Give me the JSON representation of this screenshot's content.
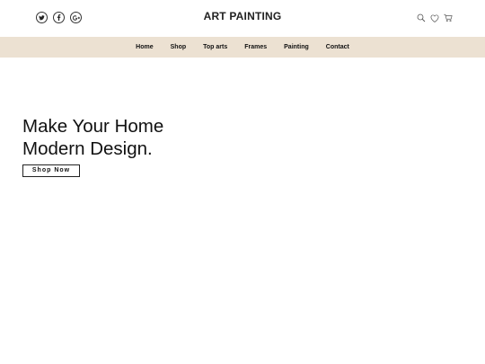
{
  "header": {
    "brand": "ART PAINTING",
    "social": [
      {
        "icon": "twitter-icon"
      },
      {
        "icon": "facebook-icon"
      },
      {
        "icon": "google-plus-icon"
      }
    ],
    "utilities": [
      {
        "icon": "search-icon"
      },
      {
        "icon": "heart-icon"
      },
      {
        "icon": "cart-icon"
      }
    ]
  },
  "nav": {
    "items": [
      {
        "label": "Home"
      },
      {
        "label": "Shop"
      },
      {
        "label": "Top arts"
      },
      {
        "label": "Frames"
      },
      {
        "label": "Painting"
      },
      {
        "label": "Contact"
      }
    ],
    "background": "#ece1d2"
  },
  "hero": {
    "title_line1": "Make Your Home",
    "title_line2": "Modern Design.",
    "cta_label": "Shop Now"
  }
}
